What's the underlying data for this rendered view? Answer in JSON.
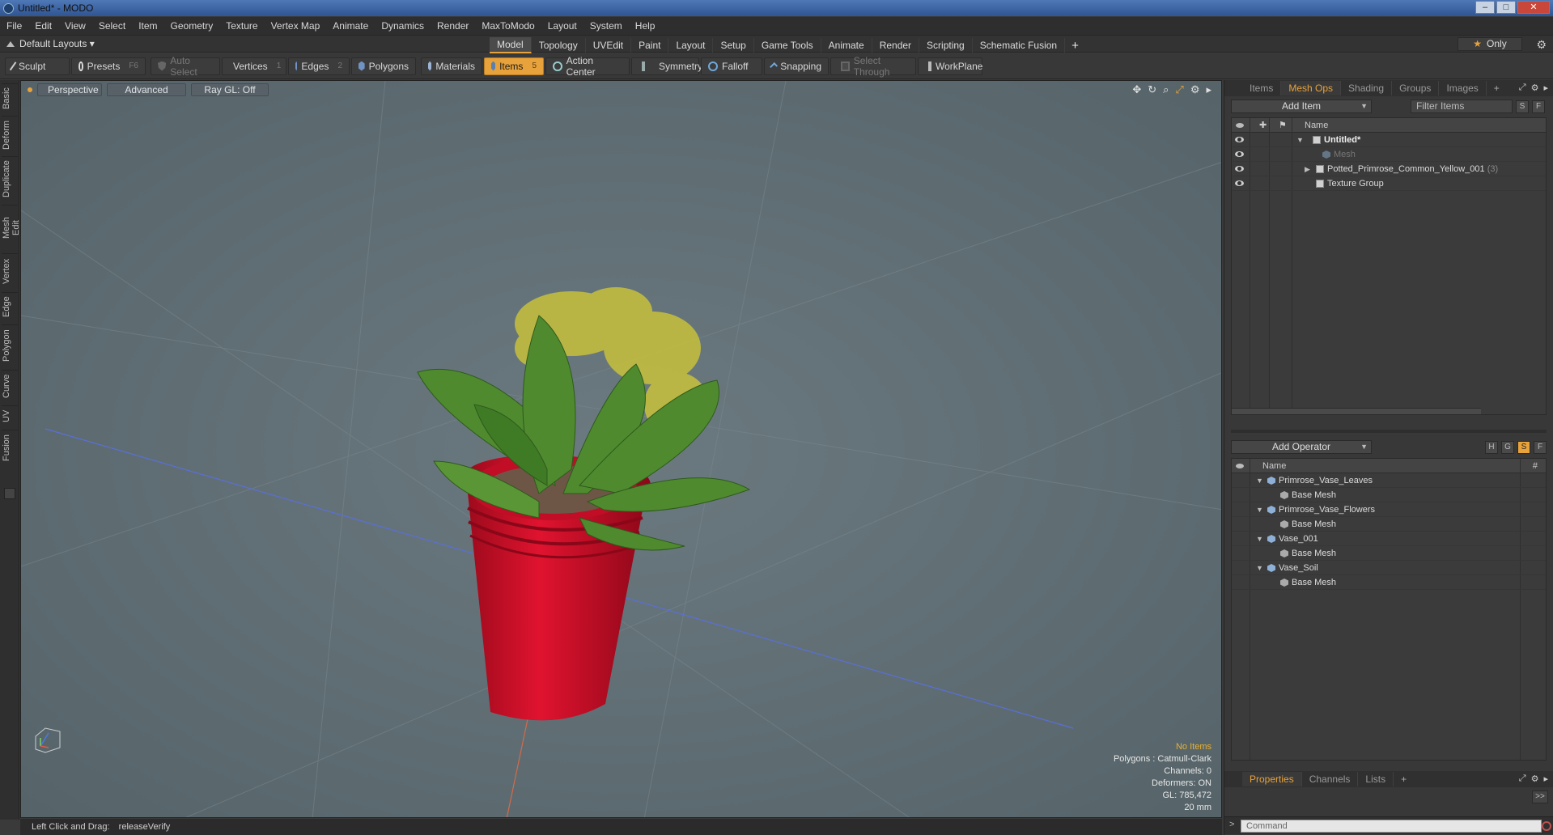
{
  "window": {
    "title": "Untitled* - MODO",
    "minimize": "–",
    "maximize": "□",
    "close": "✕"
  },
  "menu": [
    "File",
    "Edit",
    "View",
    "Select",
    "Item",
    "Geometry",
    "Texture",
    "Vertex Map",
    "Animate",
    "Dynamics",
    "Render",
    "MaxToModo",
    "Layout",
    "System",
    "Help"
  ],
  "modebar": {
    "layout_label": "Default Layouts ▾",
    "tabs": [
      "Model",
      "Topology",
      "UVEdit",
      "Paint",
      "Layout",
      "Setup",
      "Game Tools",
      "Animate",
      "Render",
      "Scripting",
      "Schematic Fusion"
    ],
    "active_tab": "Model",
    "add_tab": "+",
    "only_label": "Only",
    "star": "★",
    "gear": "⚙"
  },
  "toolbar": {
    "sculpt": "Sculpt",
    "presets": "Presets",
    "presets_key": "F6",
    "auto_select": "Auto Select",
    "vertices": "Vertices",
    "vertices_key": "1",
    "edges": "Edges",
    "edges_key": "2",
    "polygons": "Polygons",
    "materials": "Materials",
    "items": "Items",
    "items_key": "5",
    "action_center": "Action Center",
    "symmetry": "Symmetry",
    "falloff": "Falloff",
    "snapping": "Snapping",
    "select_through": "Select Through",
    "workplane": "WorkPlane"
  },
  "sidetabs": [
    "Basic",
    "Deform",
    "Duplicate",
    "Mesh Edit",
    "Vertex",
    "Edge",
    "Polygon",
    "Curve",
    "UV",
    "Fusion"
  ],
  "viewport": {
    "view_mode": "Perspective",
    "shading": "Advanced",
    "raygl": "Ray GL: Off",
    "info": {
      "selection": "No Items",
      "polygons": "Polygons : Catmull-Clark",
      "channels": "Channels: 0",
      "deformers": "Deformers: ON",
      "gl": "GL: 785,472",
      "scale": "20 mm"
    },
    "colors": {
      "background": "#5f6f76",
      "pot": "#d4112b",
      "leaves": "#4f8a2f",
      "flowers": "#c9c43a"
    }
  },
  "status": {
    "hint": "Left Click and Drag:",
    "command": "releaseVerify"
  },
  "items_panel": {
    "tabs": [
      "Items",
      "Mesh Ops",
      "Shading",
      "Groups",
      "Images"
    ],
    "active_tab": "Mesh Ops",
    "add_tab": "+",
    "add_item": "Add Item",
    "filter_placeholder": "Filter Items",
    "btn_s": "S",
    "btn_f": "F",
    "col_name": "Name",
    "rows": [
      {
        "name": "Untitled*",
        "count": ""
      },
      {
        "name": "Mesh",
        "count": ""
      },
      {
        "name": "Potted_Primrose_Common_Yellow_001",
        "count": "(3)"
      },
      {
        "name": "Texture Group",
        "count": ""
      }
    ]
  },
  "meshops_panel": {
    "add_operator": "Add Operator",
    "btns": [
      "H",
      "G",
      "S",
      "F"
    ],
    "col_name": "Name",
    "col_hash": "#",
    "rows": [
      {
        "name": "Primrose_Vase_Leaves"
      },
      {
        "name": "Base Mesh"
      },
      {
        "name": "Primrose_Vase_Flowers"
      },
      {
        "name": "Base Mesh"
      },
      {
        "name": "Vase_001"
      },
      {
        "name": "Base Mesh"
      },
      {
        "name": "Vase_Soil"
      },
      {
        "name": "Base Mesh"
      }
    ]
  },
  "bottom_tabs": {
    "tabs": [
      "Properties",
      "Channels",
      "Lists"
    ],
    "active_tab": "Properties",
    "add_tab": "+",
    "expand": ">>"
  },
  "command": {
    "placeholder": "Command",
    "arrow": ">"
  }
}
